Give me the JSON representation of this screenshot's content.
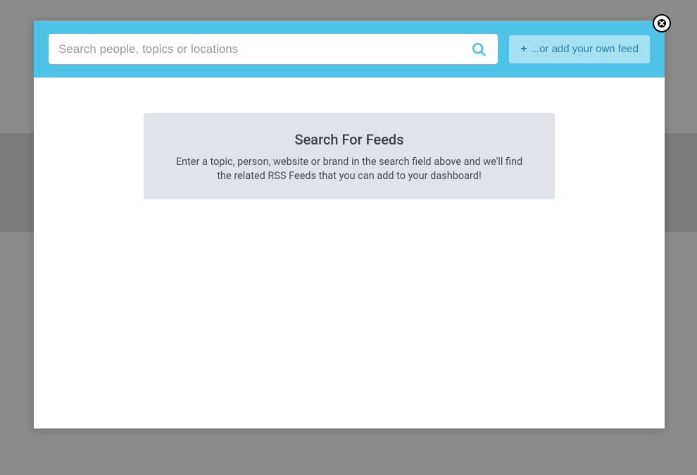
{
  "header": {
    "search_placeholder": "Search people, topics or locations",
    "add_feed_label": "...or add your own feed"
  },
  "info": {
    "title": "Search For Feeds",
    "text": "Enter a topic, person, website or brand in the search field above and we'll find the related RSS Feeds that you can add to your dashboard!"
  }
}
